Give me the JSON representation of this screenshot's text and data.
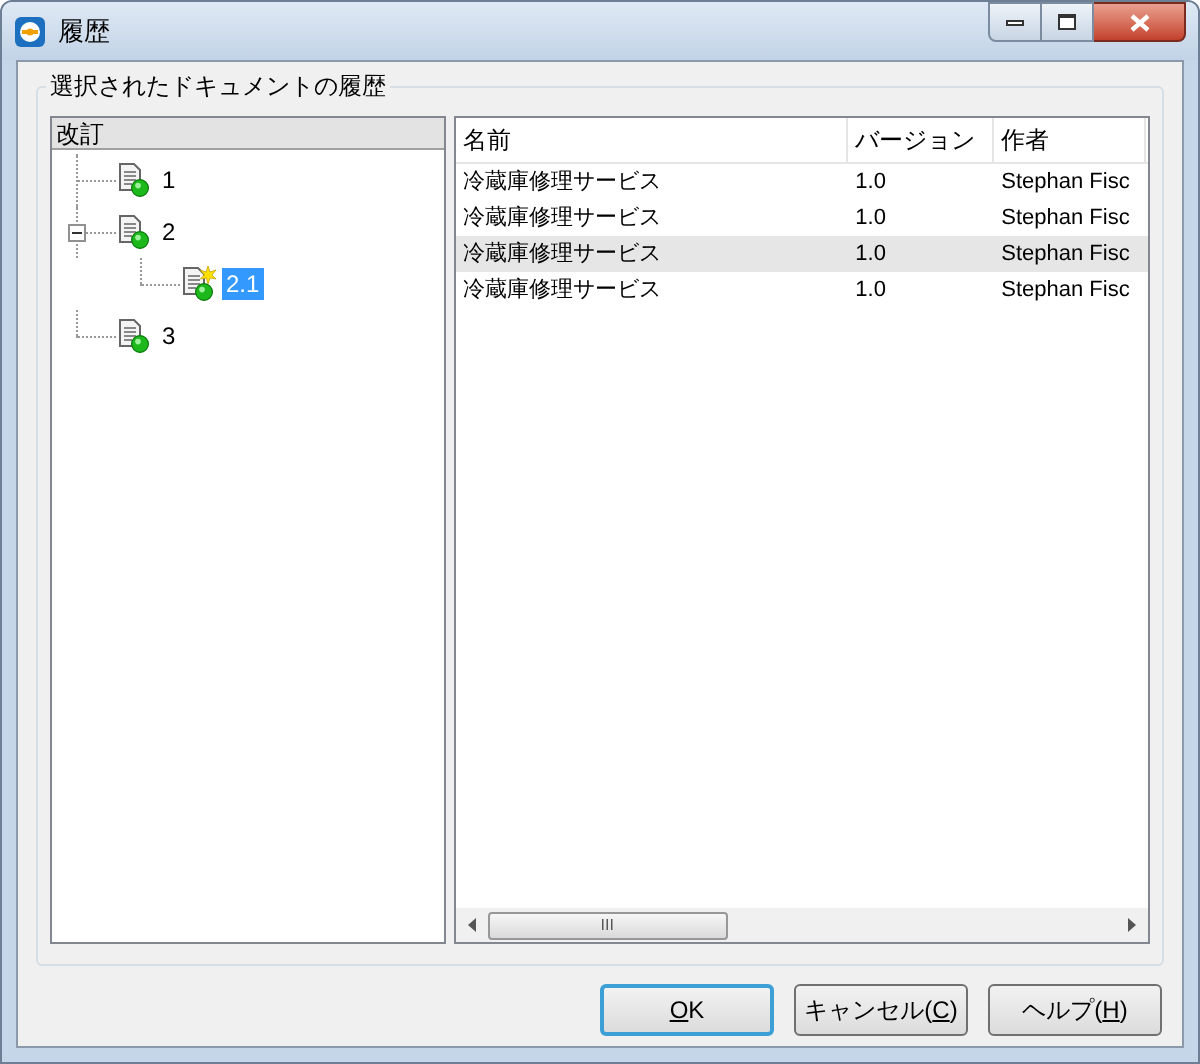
{
  "window": {
    "title": "履歴"
  },
  "group": {
    "label": "選択されたドキュメントの履歴"
  },
  "tree": {
    "header": "改訂",
    "items": [
      {
        "label": "1",
        "kind": "doc",
        "selected": false
      },
      {
        "label": "2",
        "kind": "doc",
        "selected": false,
        "expanded": true,
        "children": [
          {
            "label": "2.1",
            "kind": "new",
            "selected": true
          }
        ]
      },
      {
        "label": "3",
        "kind": "doc",
        "selected": false
      }
    ]
  },
  "table": {
    "columns": [
      "名前",
      "バージョン",
      "作者"
    ],
    "rows": [
      {
        "cells": [
          "冷蔵庫修理サービス",
          "1.0",
          "Stephan Fisc"
        ],
        "selected": false
      },
      {
        "cells": [
          "冷蔵庫修理サービス",
          "1.0",
          "Stephan Fisc"
        ],
        "selected": false
      },
      {
        "cells": [
          "冷蔵庫修理サービス",
          "1.0",
          "Stephan Fisc"
        ],
        "selected": true
      },
      {
        "cells": [
          "冷蔵庫修理サービス",
          "1.0",
          "Stephan Fisc"
        ],
        "selected": false
      }
    ],
    "scrollbar_grip": "III"
  },
  "buttons": [
    {
      "mnemonic": "O",
      "after": "K",
      "default": true
    },
    {
      "before": "キャンセル(",
      "mnemonic": "C",
      "after": ")",
      "default": false
    },
    {
      "before": "ヘルプ(",
      "mnemonic": "H",
      "after": ")",
      "default": false
    }
  ]
}
